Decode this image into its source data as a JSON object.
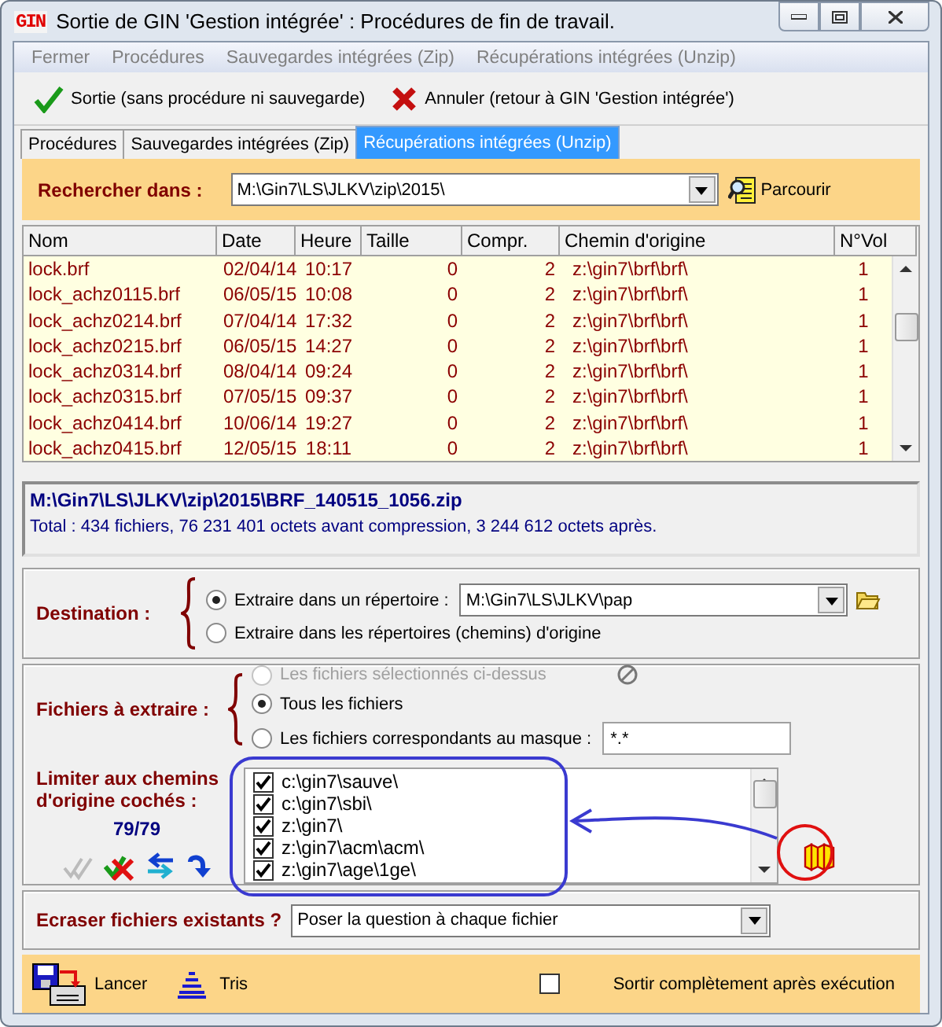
{
  "window": {
    "logo": "GIN",
    "title": "Sortie de GIN 'Gestion intégrée' : Procédures de fin de travail."
  },
  "menu": [
    {
      "label": "Fermer"
    },
    {
      "label": "Procédures"
    },
    {
      "label": "Sauvegardes intégrées (Zip)"
    },
    {
      "label": "Récupérations intégrées (Unzip)"
    }
  ],
  "toolbar": [
    {
      "kind": "ok",
      "label": "Sortie (sans procédure ni sauvegarde)"
    },
    {
      "kind": "cancel",
      "label": "Annuler (retour à GIN 'Gestion intégrée')"
    }
  ],
  "tabs": [
    {
      "label": "Procédures",
      "selected": false
    },
    {
      "label": "Sauvegardes intégrées (Zip)",
      "selected": false
    },
    {
      "label": "Récupérations intégrées (Unzip)",
      "selected": true
    }
  ],
  "search": {
    "label": "Rechercher dans :",
    "value": "M:\\Gin7\\LS\\JLKV\\zip\\2015\\",
    "browse": "Parcourir"
  },
  "table": {
    "columns": [
      "Nom",
      "Date",
      "Heure",
      "Taille",
      "Compr.",
      "Chemin d'origine",
      "N°Vol"
    ],
    "rows": [
      [
        "lock.brf",
        "02/04/14",
        "10:17",
        "0",
        "2",
        "z:\\gin7\\brf\\brf\\",
        "1"
      ],
      [
        "lock_achz0115.brf",
        "06/05/15",
        "10:08",
        "0",
        "2",
        "z:\\gin7\\brf\\brf\\",
        "1"
      ],
      [
        "lock_achz0214.brf",
        "07/04/14",
        "17:32",
        "0",
        "2",
        "z:\\gin7\\brf\\brf\\",
        "1"
      ],
      [
        "lock_achz0215.brf",
        "06/05/15",
        "14:27",
        "0",
        "2",
        "z:\\gin7\\brf\\brf\\",
        "1"
      ],
      [
        "lock_achz0314.brf",
        "08/04/14",
        "09:24",
        "0",
        "2",
        "z:\\gin7\\brf\\brf\\",
        "1"
      ],
      [
        "lock_achz0315.brf",
        "07/05/15",
        "09:37",
        "0",
        "2",
        "z:\\gin7\\brf\\brf\\",
        "1"
      ],
      [
        "lock_achz0414.brf",
        "10/06/14",
        "19:27",
        "0",
        "2",
        "z:\\gin7\\brf\\brf\\",
        "1"
      ],
      [
        "lock_achz0415.brf",
        "12/05/15",
        "18:11",
        "0",
        "2",
        "z:\\gin7\\brf\\brf\\",
        "1"
      ]
    ]
  },
  "archive": {
    "path": "M:\\Gin7\\LS\\JLKV\\zip\\2015\\BRF_140515_1056.zip",
    "summary": "Total : 434 fichiers, 76 231 401 octets avant compression, 3 244 612 octets après."
  },
  "destination": {
    "label": "Destination :",
    "options": [
      {
        "label": "Extraire dans un répertoire :",
        "selected": true,
        "value": "M:\\Gin7\\LS\\JLKV\\pap"
      },
      {
        "label": "Extraire dans les répertoires (chemins) d'origine",
        "selected": false
      }
    ]
  },
  "files": {
    "label": "Fichiers à extraire :",
    "options": [
      {
        "label": "Les fichiers sélectionnés ci-dessus",
        "selected": false,
        "disabled": true
      },
      {
        "label": "Tous les fichiers",
        "selected": true,
        "disabled": false
      },
      {
        "label": "Les fichiers correspondants au masque :",
        "selected": false,
        "disabled": false,
        "value": "*.*"
      }
    ]
  },
  "paths": {
    "label": "Limiter aux chemins d'origine cochés :",
    "count": "79/79",
    "items": [
      {
        "label": "c:\\gin7\\sauve\\",
        "checked": true
      },
      {
        "label": "c:\\gin7\\sbi\\",
        "checked": true
      },
      {
        "label": "z:\\gin7\\",
        "checked": true
      },
      {
        "label": "z:\\gin7\\acm\\acm\\",
        "checked": true
      },
      {
        "label": "z:\\gin7\\age\\1ge\\",
        "checked": true
      }
    ]
  },
  "overwrite": {
    "label": "Ecraser fichiers existants ?",
    "value": "Poser la question à chaque fichier"
  },
  "footer": {
    "launch": "Lancer",
    "sort": "Tris",
    "exit": {
      "label": "Sortir complètement après exécution",
      "checked": false
    }
  }
}
